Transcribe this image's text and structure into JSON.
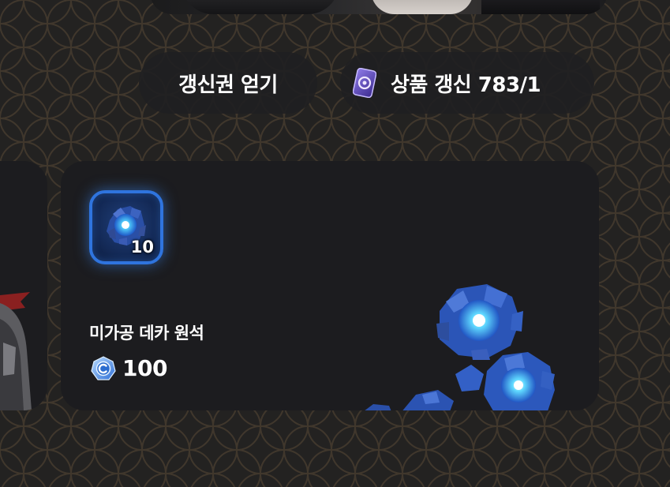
{
  "header": {
    "earn_ticket_label": "갱신권 얻기",
    "refresh_label": "상품 갱신 783/1"
  },
  "shop": {
    "item": {
      "name": "미가공 데카 원석",
      "quantity": "10",
      "price": "100",
      "currency_icon": "crystal-coin-icon",
      "item_icon": "blue-ore-icon"
    }
  },
  "colors": {
    "background": "#232221",
    "card": "#1c1c1f",
    "pill": "#202022",
    "slot_border": "#2f74de",
    "ore_blue": "#2f7df0"
  }
}
